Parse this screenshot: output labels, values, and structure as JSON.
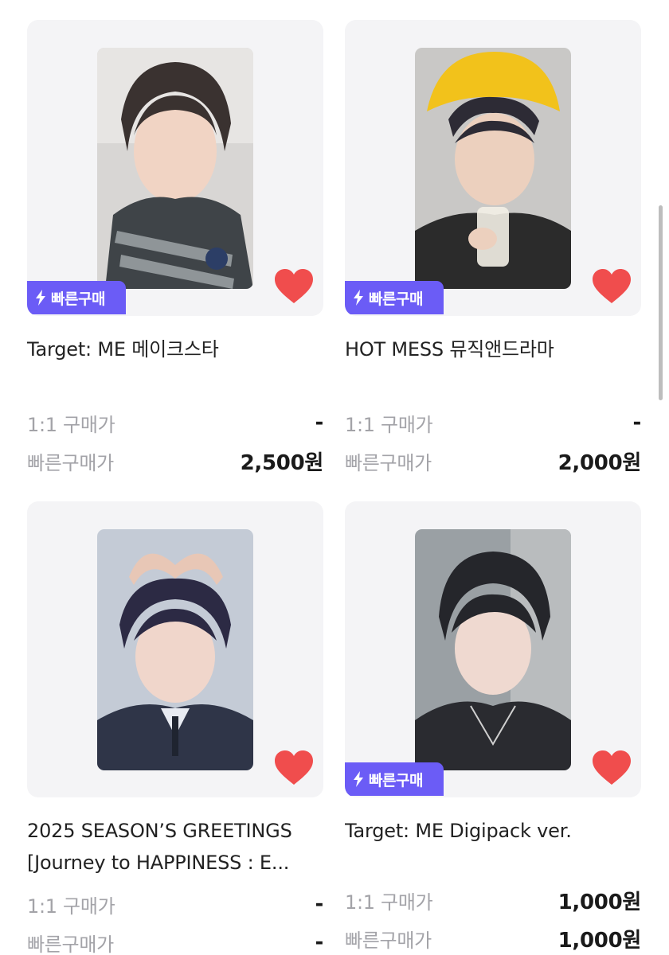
{
  "products": [
    {
      "title": "Target: ME 메이크스타",
      "badge": "빠른구매",
      "price_1to1_label": "1:1 구매가",
      "price_1to1": "-",
      "quick_price_label": "빠른구매가",
      "quick_price": "2,500원",
      "show_badge": true,
      "liked": true
    },
    {
      "title": "HOT MESS 뮤직앤드라마",
      "badge": "빠른구매",
      "price_1to1_label": "1:1 구매가",
      "price_1to1": "-",
      "quick_price_label": "빠른구매가",
      "quick_price": "2,000원",
      "show_badge": true,
      "liked": true
    },
    {
      "title": "2025 SEASON’S GREETINGS [Journey to HAPPINESS : E...",
      "badge": "",
      "price_1to1_label": "1:1 구매가",
      "price_1to1": "-",
      "quick_price_label": "빠른구매가",
      "quick_price": "-",
      "show_badge": false,
      "liked": true
    },
    {
      "title": "Target: ME Digipack ver.",
      "badge": "빠른구매",
      "price_1to1_label": "1:1 구매가",
      "price_1to1": "1,000원",
      "quick_price_label": "빠른구매가",
      "quick_price": "1,000원",
      "show_badge": true,
      "liked": true
    }
  ],
  "colors": {
    "badge": "#6b5cf6",
    "heart": "#f04d4d",
    "card_bg": "#f4f4f6",
    "label_gray": "#a3a3a8"
  },
  "icons": {
    "badge_icon": "lightning-bolt-icon",
    "like_icon": "heart-icon"
  }
}
